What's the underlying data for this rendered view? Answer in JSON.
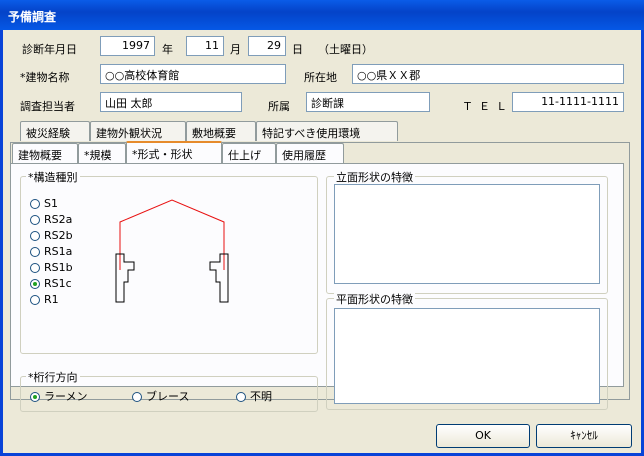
{
  "window": {
    "title": "予備調査"
  },
  "header": {
    "date_label": "診断年月日",
    "year": "1997",
    "year_unit": "年",
    "month": "11",
    "month_unit": "月",
    "day": "29",
    "day_unit": "日",
    "weekday": "（土曜日）",
    "building_name_label": "*建物名称",
    "building_name": "○○高校体育館",
    "location_label": "所在地",
    "location": "○○県ＸＸ郡",
    "person_label": "調査担当者",
    "person": "山田 太郎",
    "dept_label": "所属",
    "dept": "診断課",
    "tel_label": "ＴＥＬ",
    "tel": "11-1111-1111"
  },
  "tabs_top": [
    "被災経験",
    "建物外観状況",
    "敷地概要",
    "特記すべき使用環境"
  ],
  "tabs_bottom": [
    "建物概要",
    "*規模",
    "*形式・形状",
    "仕上げ",
    "使用履歴"
  ],
  "structure": {
    "title": "*構造種別",
    "options": [
      "S1",
      "RS2a",
      "RS2b",
      "RS1a",
      "RS1b",
      "RS1c",
      "R1"
    ],
    "selected": "RS1c",
    "colors": {
      "roof": "#e81010",
      "column": "#000000"
    }
  },
  "direction": {
    "title": "*桁行方向",
    "options": [
      "ラーメン",
      "ブレース",
      "不明"
    ],
    "selected": "ラーメン"
  },
  "elevation": {
    "title": "立面形状の特徴",
    "value": ""
  },
  "plan": {
    "title": "平面形状の特徴",
    "value": ""
  },
  "buttons": {
    "ok": "OK",
    "cancel": "ｷｬﾝｾﾙ"
  }
}
